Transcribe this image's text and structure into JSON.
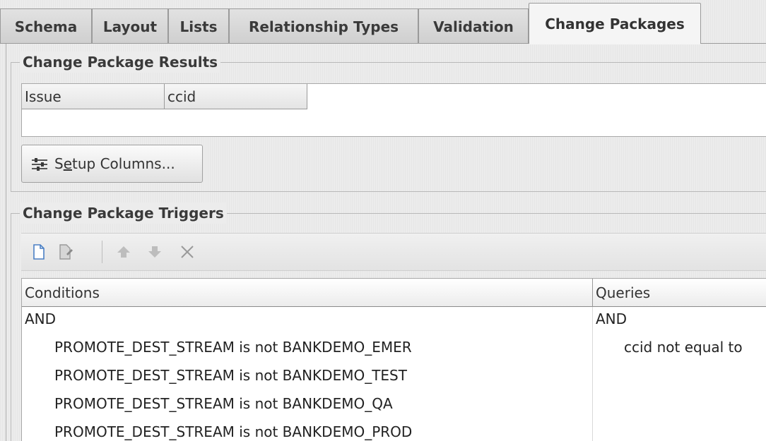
{
  "tabs": [
    {
      "label": "Schema"
    },
    {
      "label": "Layout"
    },
    {
      "label": "Lists"
    },
    {
      "label": "Relationship Types"
    },
    {
      "label": "Validation"
    },
    {
      "label": "Change Packages",
      "active": true
    }
  ],
  "results": {
    "title": "Change Package Results",
    "columns": [
      "Issue",
      "ccid"
    ],
    "setup_button": {
      "prefix": "S",
      "underlined": "e",
      "suffix": "tup Columns...",
      "icon": "setup-columns-icon"
    }
  },
  "triggers": {
    "title": "Change Package Triggers",
    "toolbar": [
      {
        "icon": "new-document-icon"
      },
      {
        "icon": "edit-document-icon"
      },
      {
        "icon": "move-up-icon"
      },
      {
        "icon": "move-down-icon"
      },
      {
        "icon": "delete-icon"
      }
    ],
    "columns": [
      "Conditions",
      "Queries"
    ],
    "conditions": {
      "operator": "AND",
      "items": [
        "PROMOTE_DEST_STREAM is not BANKDEMO_EMER",
        "PROMOTE_DEST_STREAM is not BANKDEMO_TEST",
        "PROMOTE_DEST_STREAM is not BANKDEMO_QA",
        "PROMOTE_DEST_STREAM is not BANKDEMO_PROD"
      ]
    },
    "queries": {
      "operator": "AND",
      "items": [
        "ccid not equal to"
      ]
    }
  }
}
